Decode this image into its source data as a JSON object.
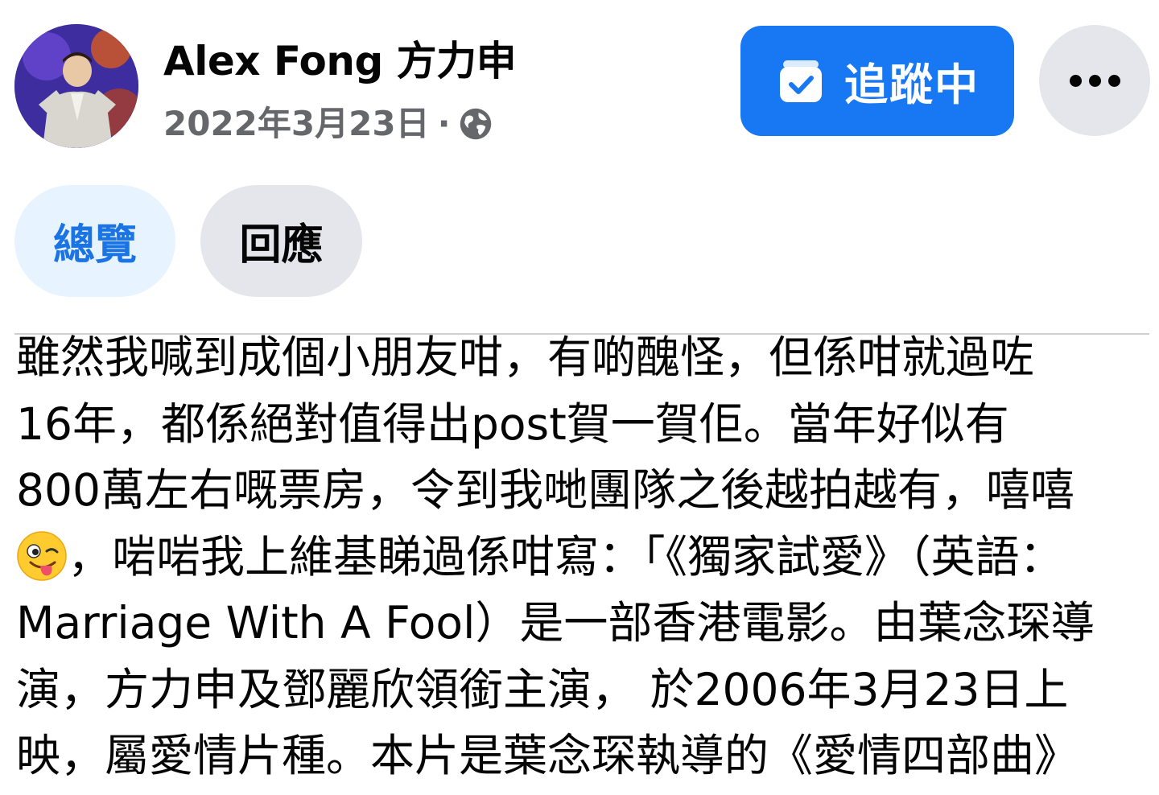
{
  "post": {
    "author_name": "Alex Fong 方力申",
    "date": "2022年3月23日",
    "separator": "·",
    "visibility_icon": "globe-icon",
    "follow_button": {
      "label": "追蹤中",
      "icon": "bell-check-icon",
      "color": "#1877f2"
    },
    "more_button": {
      "icon": "more-options-icon"
    }
  },
  "tabs": [
    {
      "label": "總覽",
      "active": true
    },
    {
      "label": "回應",
      "active": false
    }
  ],
  "body": {
    "lines": [
      "雖然我喊到成個小朋友咁，有啲醜怪，但係咁就過咗",
      "16年，都係絕對值得出post賀一賀佢。當年好似有",
      "800萬左右嘅票房，令到我哋團隊之後越拍越有，嘻嘻",
      "，啱啱我上維基睇過係咁寫：「《獨家試愛》（英語：",
      "Marriage With A Fool）是一部香港電影。由葉念琛導",
      "演，方力申及鄧麗欣領銜主演， 於2006年3月23日上",
      "映，屬愛情片種。本片是葉念琛執導的《愛情四部曲》"
    ],
    "emoji": "winking-face-with-tongue"
  }
}
